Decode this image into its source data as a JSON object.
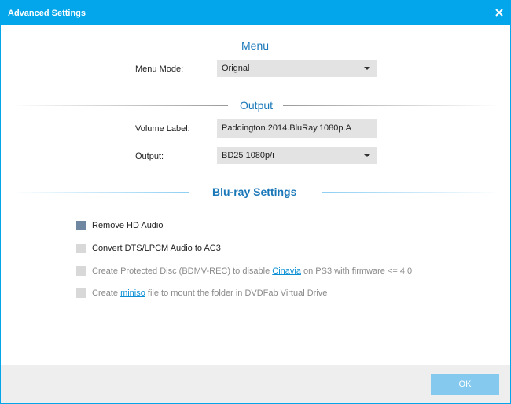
{
  "window": {
    "title": "Advanced Settings",
    "close_label": "×"
  },
  "menu_section": {
    "title": "Menu",
    "menu_mode_label": "Menu Mode:",
    "menu_mode_value": "Orignal"
  },
  "output_section": {
    "title": "Output",
    "volume_label_label": "Volume Label:",
    "volume_label_value": "Paddington.2014.BluRay.1080p.A",
    "output_label": "Output:",
    "output_value": "BD25 1080p/i"
  },
  "bluray_section": {
    "title": "Blu-ray Settings",
    "options": [
      {
        "label": "Remove HD Audio",
        "checked": true,
        "enabled": true
      },
      {
        "label": "Convert DTS/LPCM Audio to AC3",
        "checked": false,
        "enabled": true
      },
      {
        "label_before": "Create Protected Disc (BDMV-REC) to disable ",
        "link": "Cinavia",
        "label_after": " on PS3 with firmware <= 4.0",
        "checked": false,
        "enabled": false
      },
      {
        "label_before": "Create ",
        "link": "miniso",
        "label_after": " file to mount the folder in DVDFab Virtual Drive",
        "checked": false,
        "enabled": false
      }
    ]
  },
  "footer": {
    "ok_label": "OK"
  },
  "colors": {
    "titlebar": "#03a6ea",
    "section_title": "#1a78b8",
    "link": "#0a8fd4",
    "checkbox_checked": "#6f87a0",
    "ok_button": "#86c9ef"
  }
}
